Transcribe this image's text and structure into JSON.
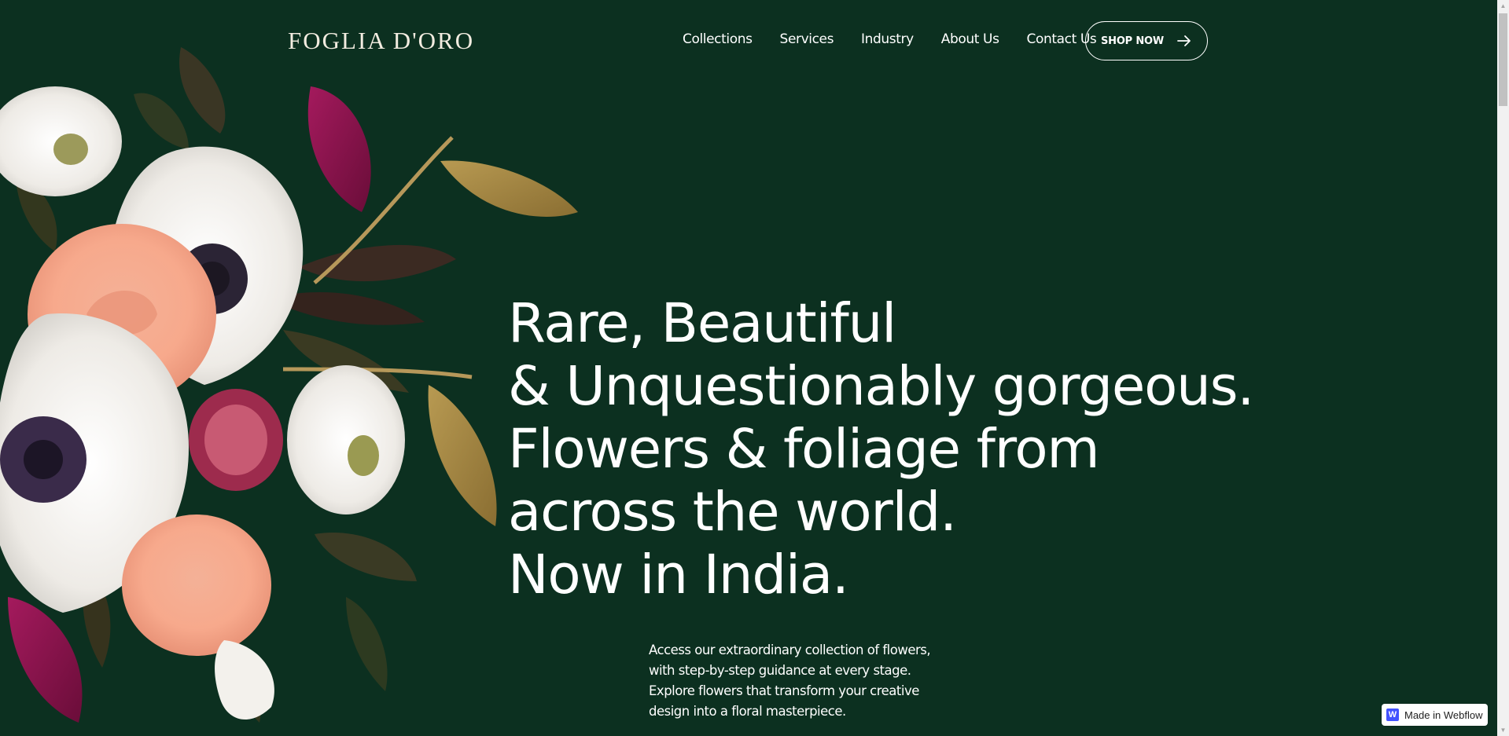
{
  "brand": {
    "logo_text": "FOGLIA D'ORO"
  },
  "nav": {
    "items": [
      {
        "label": "Collections"
      },
      {
        "label": "Services"
      },
      {
        "label": "Industry"
      },
      {
        "label": "About Us"
      },
      {
        "label": "Contact Us"
      }
    ],
    "cta_label": "SHOP NOW",
    "cta_icon": "arrow-right-icon"
  },
  "hero": {
    "lines": [
      "Rare, Beautiful",
      "& Unquestionably gorgeous.",
      "Flowers & foliage from",
      "across the world.",
      "Now in India."
    ],
    "description_lines": [
      "Access our extraordinary collection of flowers,",
      "with step-by-step guidance at every stage.",
      "Explore flowers that transform your creative",
      "design into a floral masterpiece."
    ]
  },
  "badge": {
    "label": "Made in Webflow",
    "icon": "webflow-icon"
  },
  "colors": {
    "background": "#0c3020",
    "text": "#ffffff",
    "logo": "#f2ece0",
    "webflow_blue": "#4353ff"
  }
}
